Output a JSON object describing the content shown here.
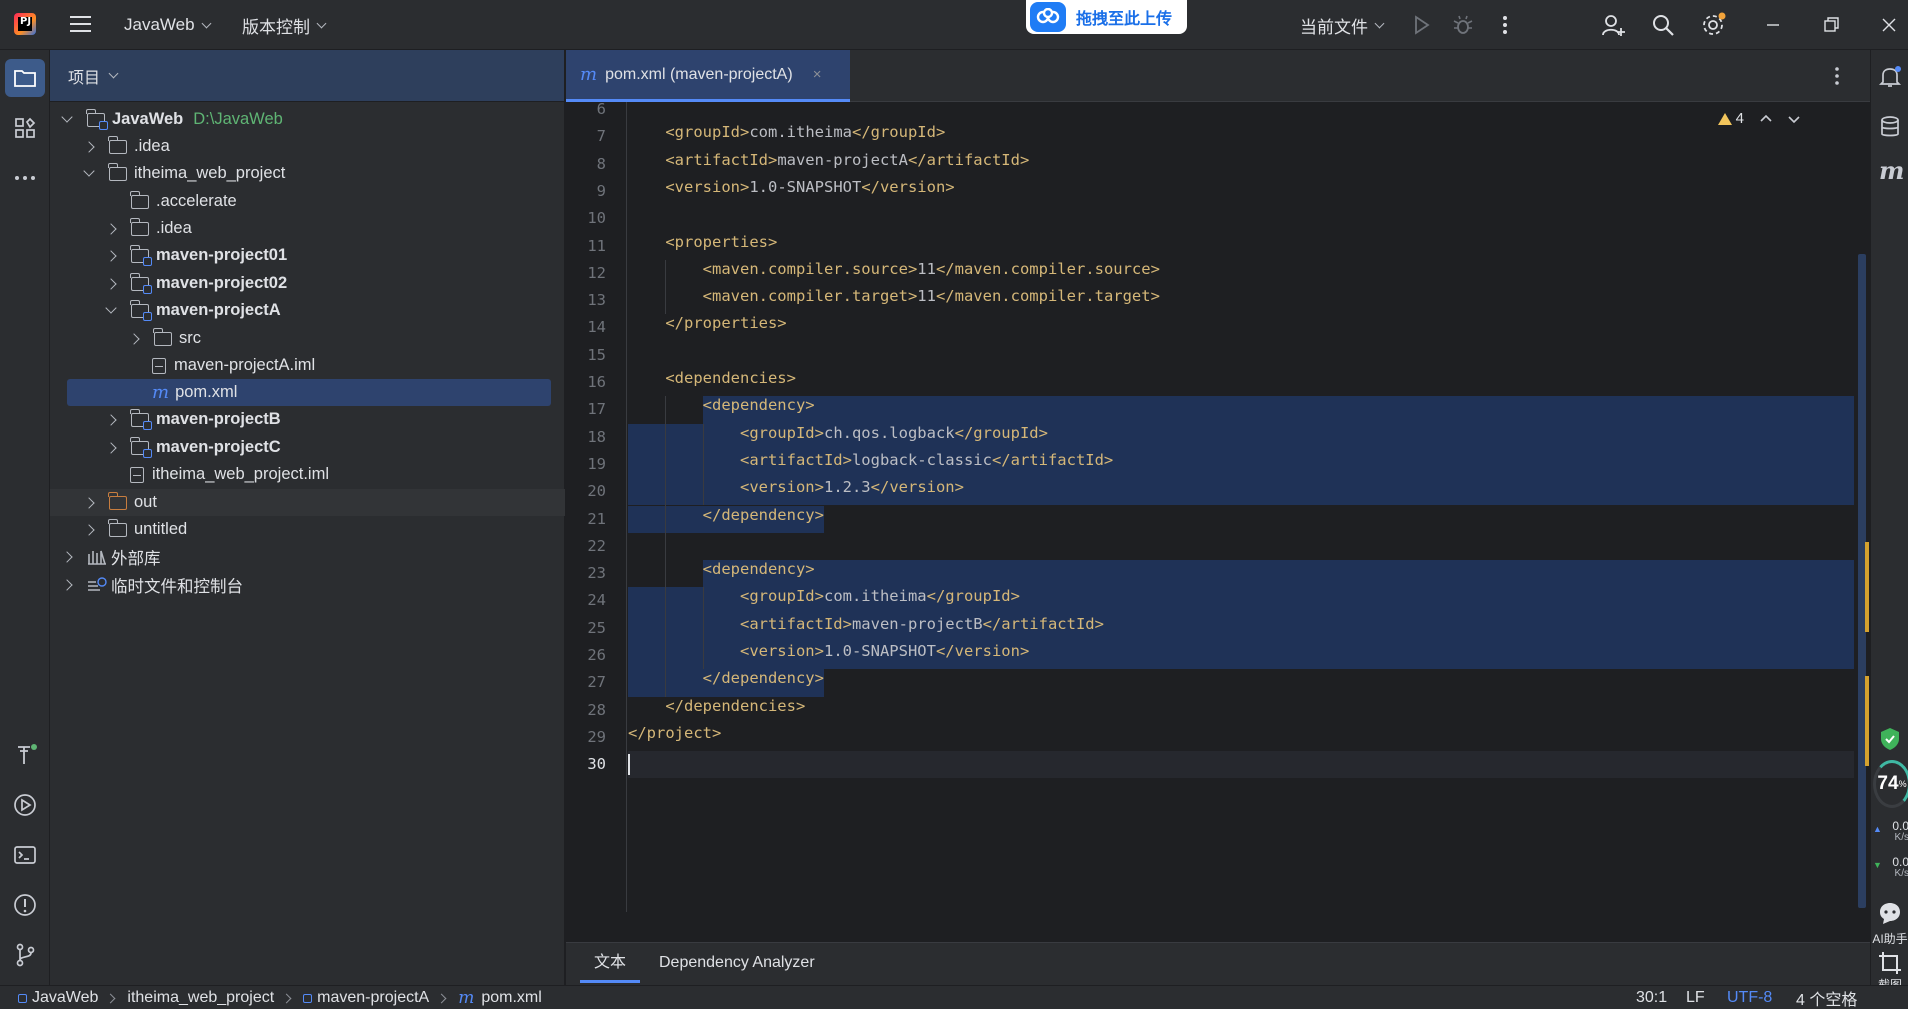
{
  "titlebar": {
    "app_logo": "PJ",
    "project_name": "JavaWeb",
    "vcs_menu": "版本控制",
    "upload_label": "拖拽至此上传",
    "run_config": "当前文件"
  },
  "left_strip": {
    "icons": [
      "project-icon",
      "structure-icon",
      "more-icon",
      "build-icon",
      "run-icon",
      "terminal-icon",
      "problems-icon",
      "git-icon"
    ]
  },
  "project_panel": {
    "title": "项目",
    "tree": [
      {
        "label": "JavaWeb",
        "path": "D:\\JavaWeb",
        "bold": true
      },
      {
        "label": ".idea"
      },
      {
        "label": "itheima_web_project"
      },
      {
        "label": ".accelerate"
      },
      {
        "label": ".idea"
      },
      {
        "label": "maven-project01",
        "bold": true
      },
      {
        "label": "maven-project02",
        "bold": true
      },
      {
        "label": "maven-projectA",
        "bold": true
      },
      {
        "label": "src"
      },
      {
        "label": "maven-projectA.iml"
      },
      {
        "label": "pom.xml",
        "selected": true
      },
      {
        "label": "maven-projectB",
        "bold": true
      },
      {
        "label": "maven-projectC",
        "bold": true
      },
      {
        "label": "itheima_web_project.iml"
      },
      {
        "label": "out"
      },
      {
        "label": "untitled"
      },
      {
        "label": "外部库"
      },
      {
        "label": "临时文件和控制台"
      }
    ]
  },
  "editor": {
    "tab_label": "pom.xml (maven-projectA)",
    "tab_icon": "m",
    "close_glyph": "×",
    "warning_count": "4",
    "line_numbers": [
      "6",
      "7",
      "8",
      "9",
      "10",
      "11",
      "12",
      "13",
      "14",
      "15",
      "16",
      "17",
      "18",
      "19",
      "20",
      "21",
      "22",
      "23",
      "24",
      "25",
      "26",
      "27",
      "28",
      "29",
      "30"
    ],
    "code_lines": [
      "",
      "    <groupId>com.itheima</groupId>",
      "    <artifactId>maven-projectA</artifactId>",
      "    <version>1.0-SNAPSHOT</version>",
      "",
      "    <properties>",
      "        <maven.compiler.source>11</maven.compiler.source>",
      "        <maven.compiler.target>11</maven.compiler.target>",
      "    </properties>",
      "",
      "    <dependencies>",
      "        <dependency>",
      "            <groupId>ch.qos.logback</groupId>",
      "            <artifactId>logback-classic</artifactId>",
      "            <version>1.2.3</version>",
      "        </dependency>",
      "",
      "        <dependency>",
      "            <groupId>com.itheima</groupId>",
      "            <artifactId>maven-projectB</artifactId>",
      "            <version>1.0-SNAPSHOT</version>",
      "        </dependency>",
      "    </dependencies>",
      "</project>",
      ""
    ],
    "bottom_tabs": [
      "文本",
      "Dependency Analyzer"
    ]
  },
  "right_strip": {
    "cpu_percent": "74",
    "percent_sign": "%",
    "upload_speed": "0.0",
    "download_speed": "0.0",
    "speed_unit": "K/s",
    "ai_label": "AI助手",
    "screenshot_label": "截图"
  },
  "statusbar": {
    "breadcrumbs": [
      "JavaWeb",
      "itheima_web_project",
      "maven-projectA",
      "pom.xml"
    ],
    "cursor_pos": "30:1",
    "line_sep": "LF",
    "encoding": "UTF-8",
    "indent": "4 个空格"
  },
  "colors": {
    "accent": "#548af7",
    "tag": "#d5b778",
    "selection": "#214283",
    "path_green": "#5fb574"
  }
}
